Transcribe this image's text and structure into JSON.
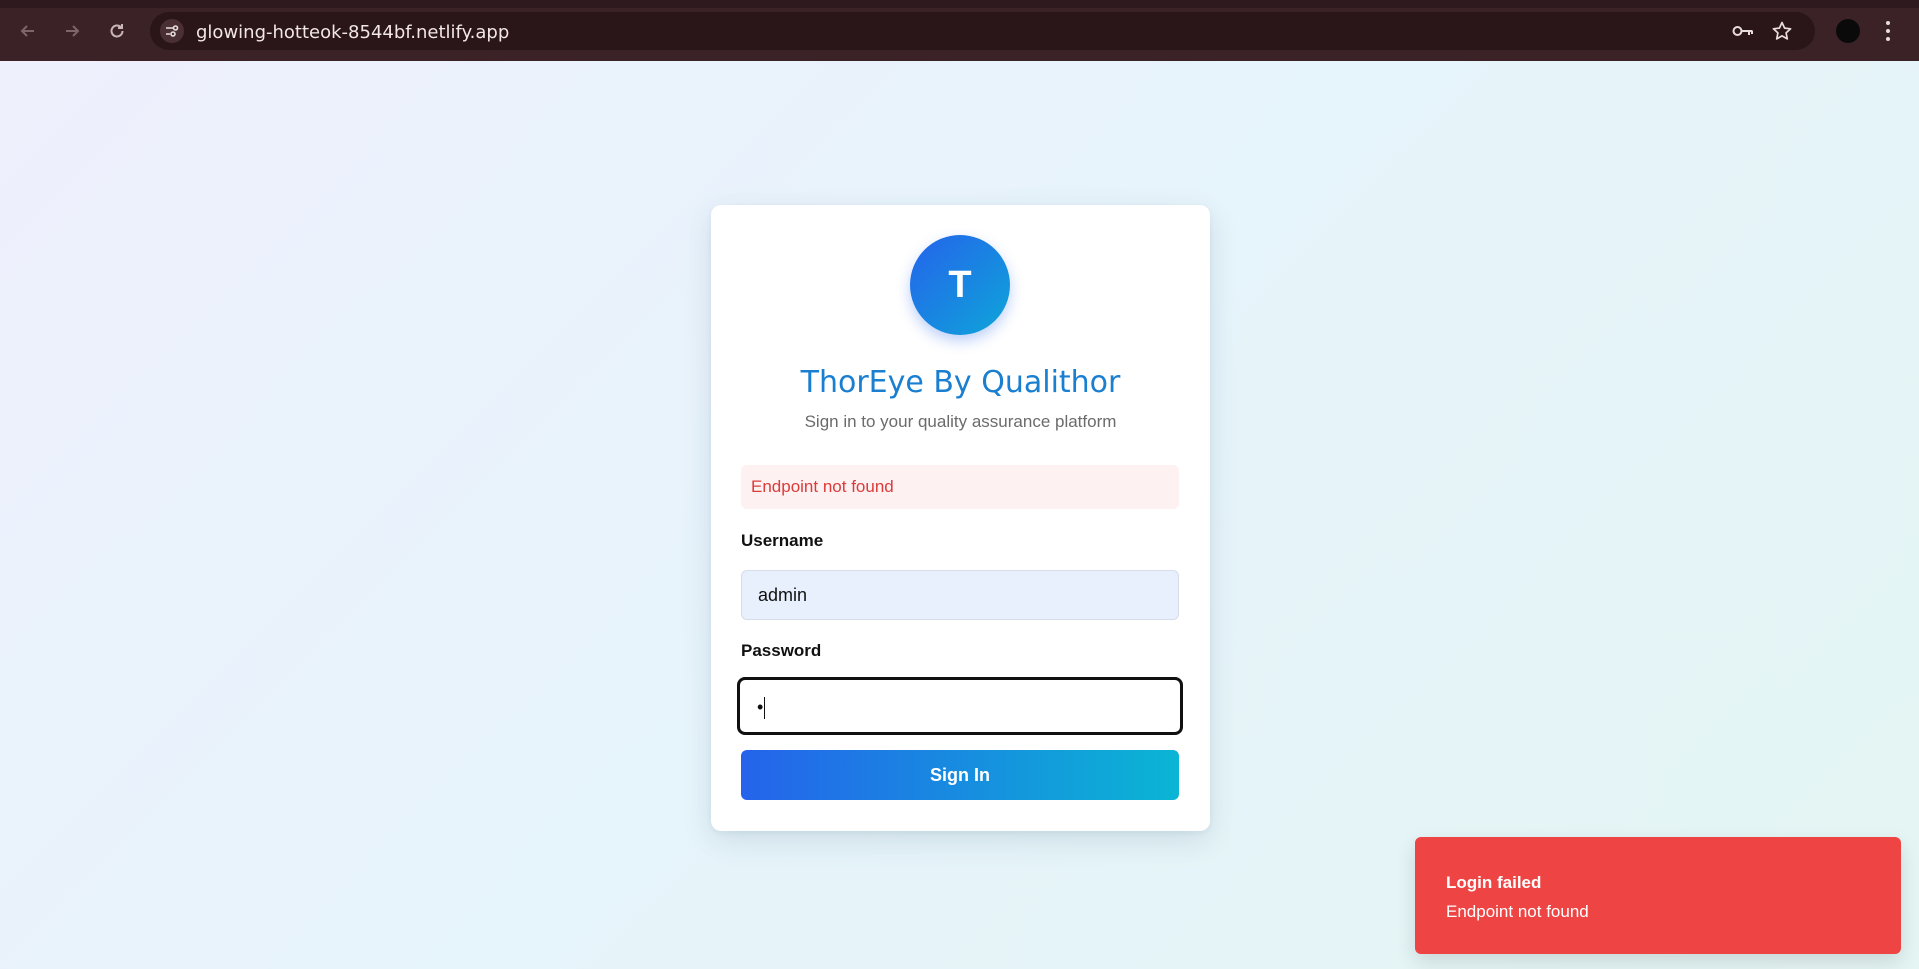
{
  "browser": {
    "url": "glowing-hotteok-8544bf.netlify.app",
    "back_icon": "arrow-left-icon",
    "forward_icon": "arrow-right-icon",
    "reload_icon": "reload-icon",
    "site_info_icon": "site-settings-icon",
    "password_icon": "key-icon",
    "bookmark_icon": "star-icon",
    "menu_icon": "kebab-menu-icon"
  },
  "login": {
    "logo_letter": "T",
    "title": "ThorEye By Qualithor",
    "subtitle": "Sign in to your quality assurance platform",
    "error_message": "Endpoint not found",
    "username_label": "Username",
    "username_value": "admin",
    "password_label": "Password",
    "password_value": "•",
    "submit_label": "Sign In"
  },
  "toast": {
    "title": "Login failed",
    "message": "Endpoint not found"
  },
  "colors": {
    "brand_blue": "#2563eb",
    "brand_cyan": "#0ab5d4",
    "title_color": "#1a7fd0",
    "error_text": "#dc3b3b",
    "error_bg": "#fef1f1",
    "toast_bg": "#ef4444"
  }
}
